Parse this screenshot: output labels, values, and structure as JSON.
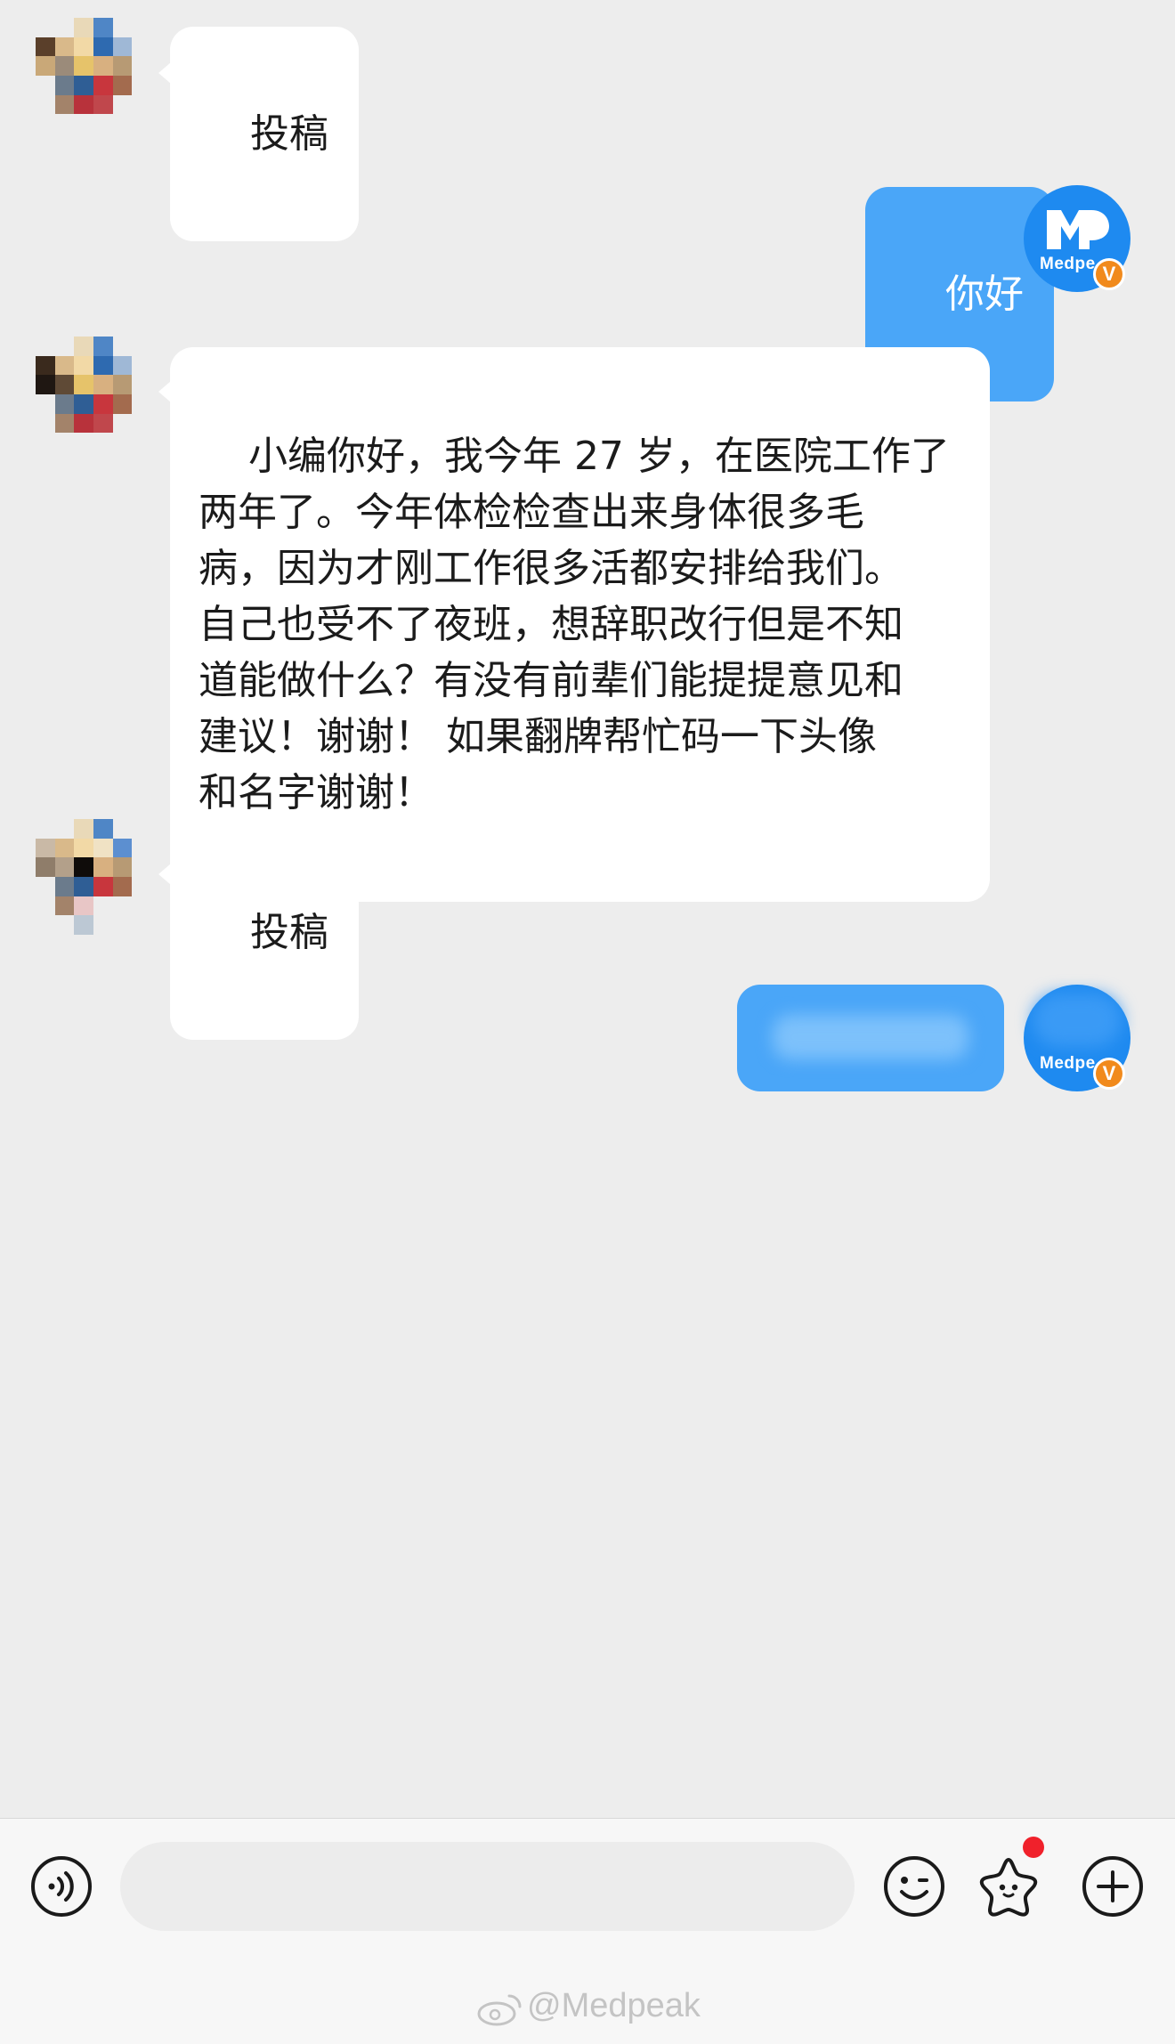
{
  "messages": [
    {
      "direction": "incoming",
      "text": "投稿"
    },
    {
      "direction": "outgoing",
      "text": "你好"
    },
    {
      "direction": "incoming",
      "text": "小编你好，我今年 27 岁，在医院工作了\n两年了。今年体检检查出来身体很多毛\n病，因为才刚工作很多活都安排给我们。\n自己也受不了夜班，想辞职改行但是不知\n道能做什么？有没有前辈们能提提意见和\n建议！谢谢！ 如果翻牌帮忙码一下头像\n和名字谢谢！"
    },
    {
      "direction": "incoming",
      "text": "投稿"
    },
    {
      "direction": "outgoing",
      "text": ""
    }
  ],
  "self_avatar": {
    "logo_text": "Medpe",
    "badge": "V",
    "color": "#1e8af0",
    "badge_color": "#f18a1c"
  },
  "input": {
    "placeholder": ""
  },
  "toolbar": {
    "voice_icon": "voice-icon",
    "emoji_icon": "emoji-icon",
    "sticker_icon": "star-sticker-icon",
    "plus_icon": "plus-icon"
  },
  "watermark": "@Medpeak",
  "colors": {
    "outgoing_bubble": "#4aa6f8",
    "incoming_bubble": "#ffffff",
    "background": "#ededed",
    "notify_dot": "#f0212b"
  }
}
